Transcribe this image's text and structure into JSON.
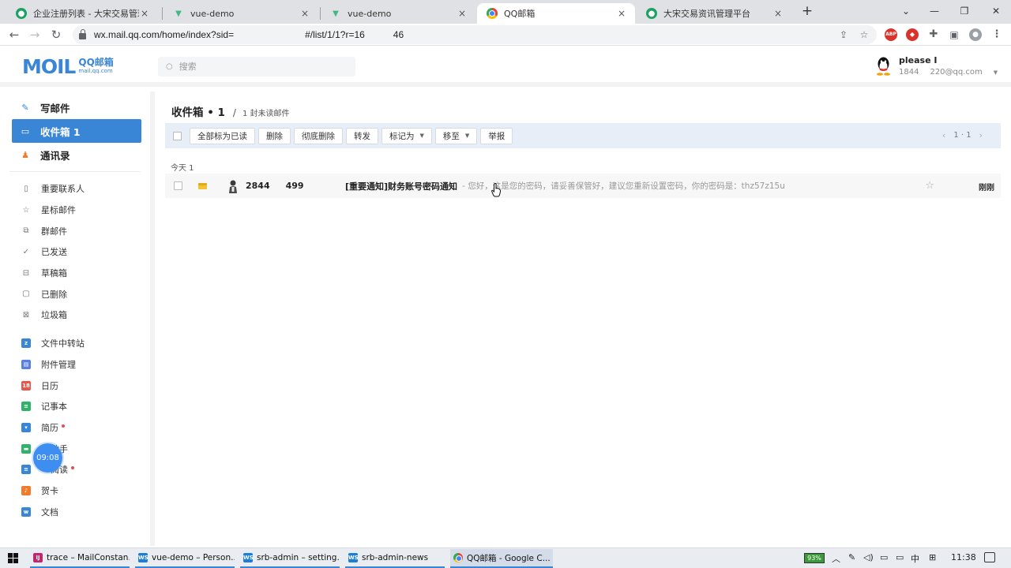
{
  "browser": {
    "tabs": [
      {
        "title": "企业注册列表 - 大宋交易管理平台",
        "icon": "srb-favicon"
      },
      {
        "title": "vue-demo",
        "icon": "vue-favicon"
      },
      {
        "title": "vue-demo",
        "icon": "vue-favicon"
      },
      {
        "title": "QQ邮箱",
        "icon": "chrome-favicon",
        "active": true
      },
      {
        "title": "大宋交易资讯管理平台",
        "icon": "srb-favicon"
      }
    ],
    "tab_close": "×",
    "new_tab": "+",
    "url": "wx.mail.qq.com/home/index?sid=               #/list/1/1?r=16      46",
    "extensions": [
      "ABP"
    ]
  },
  "header": {
    "logo_text": "MOIL",
    "logo_cn": "QQ邮箱",
    "logo_domain": "mail.qq.com",
    "search_placeholder": "搜索",
    "user_name": "please I",
    "user_id": "1844",
    "user_email": "220@qq.com"
  },
  "sidebar": {
    "main": [
      {
        "label": "写邮件",
        "icon": "pen-icon"
      },
      {
        "label": "收件箱 1",
        "icon": "inbox-icon",
        "active": true
      },
      {
        "label": "通讯录",
        "icon": "contacts-icon"
      }
    ],
    "folders": [
      {
        "label": "重要联系人",
        "icon": "bookmark-icon"
      },
      {
        "label": "星标邮件",
        "icon": "star-icon"
      },
      {
        "label": "群邮件",
        "icon": "group-mail-icon"
      },
      {
        "label": "已发送",
        "icon": "sent-icon"
      },
      {
        "label": "草稿箱",
        "icon": "draft-icon"
      },
      {
        "label": "已删除",
        "icon": "trash-icon"
      },
      {
        "label": "垃圾箱",
        "icon": "spam-icon"
      }
    ],
    "apps": [
      {
        "label": "文件中转站",
        "icon": "file-transfer-icon",
        "color": "#3a86d6"
      },
      {
        "label": "附件管理",
        "icon": "attachment-icon",
        "color": "#5b7fde"
      },
      {
        "label": "日历",
        "icon": "calendar-icon",
        "color": "#e8574a"
      },
      {
        "label": "记事本",
        "icon": "notebook-icon",
        "color": "#2fb36a"
      },
      {
        "label": "简历",
        "icon": "resume-icon",
        "color": "#3a86d6",
        "dot": true
      },
      {
        "label": "助手",
        "icon": "assistant-icon",
        "color": "#2fb36a"
      },
      {
        "label": "阅读",
        "icon": "reading-icon",
        "color": "#3a86d6",
        "dot": true
      },
      {
        "label": "贺卡",
        "icon": "card-icon",
        "color": "#f07b2c"
      },
      {
        "label": "文档",
        "icon": "doc-icon",
        "color": "#3a86d6"
      }
    ],
    "clock_bubble": "09:08"
  },
  "main": {
    "title": "收件箱 • 1",
    "separator": "/",
    "unread_text": "1 封未读邮件",
    "actions": [
      {
        "label": "全部标为已读"
      },
      {
        "label": "删除"
      },
      {
        "label": "彻底删除"
      },
      {
        "label": "转发"
      },
      {
        "label": "标记为",
        "dropdown": true
      },
      {
        "label": "移至",
        "dropdown": true
      },
      {
        "label": "举报"
      }
    ],
    "pager": {
      "prev": "‹",
      "text": "1 · 1",
      "next": "›"
    },
    "group_label": "今天 1",
    "emails": [
      {
        "sender_a": "2844",
        "sender_b": "499",
        "subject": "[重要通知]财务账号密码通知",
        "preview": "- 您好，这是您的密码，请妥善保管好，建议您重新设置密码，你的密码是：thz57z15u",
        "time": "刚刚",
        "starred": false
      }
    ]
  },
  "taskbar": {
    "items": [
      {
        "label": "trace – MailConstan...",
        "icon": "intellij-icon",
        "color": "#c0286e"
      },
      {
        "label": "vue-demo – Person...",
        "icon": "webstorm-icon",
        "color": "#1c7ed6"
      },
      {
        "label": "srb-admin – setting...",
        "icon": "webstorm-icon",
        "color": "#1c7ed6"
      },
      {
        "label": "srb-admin-news",
        "icon": "webstorm-icon",
        "color": "#1c7ed6"
      },
      {
        "label": "QQ邮箱 - Google C...",
        "icon": "chrome-icon",
        "color": "#e8574a",
        "active": true
      }
    ],
    "battery": "93%",
    "ime": "中",
    "time": "11:38"
  }
}
